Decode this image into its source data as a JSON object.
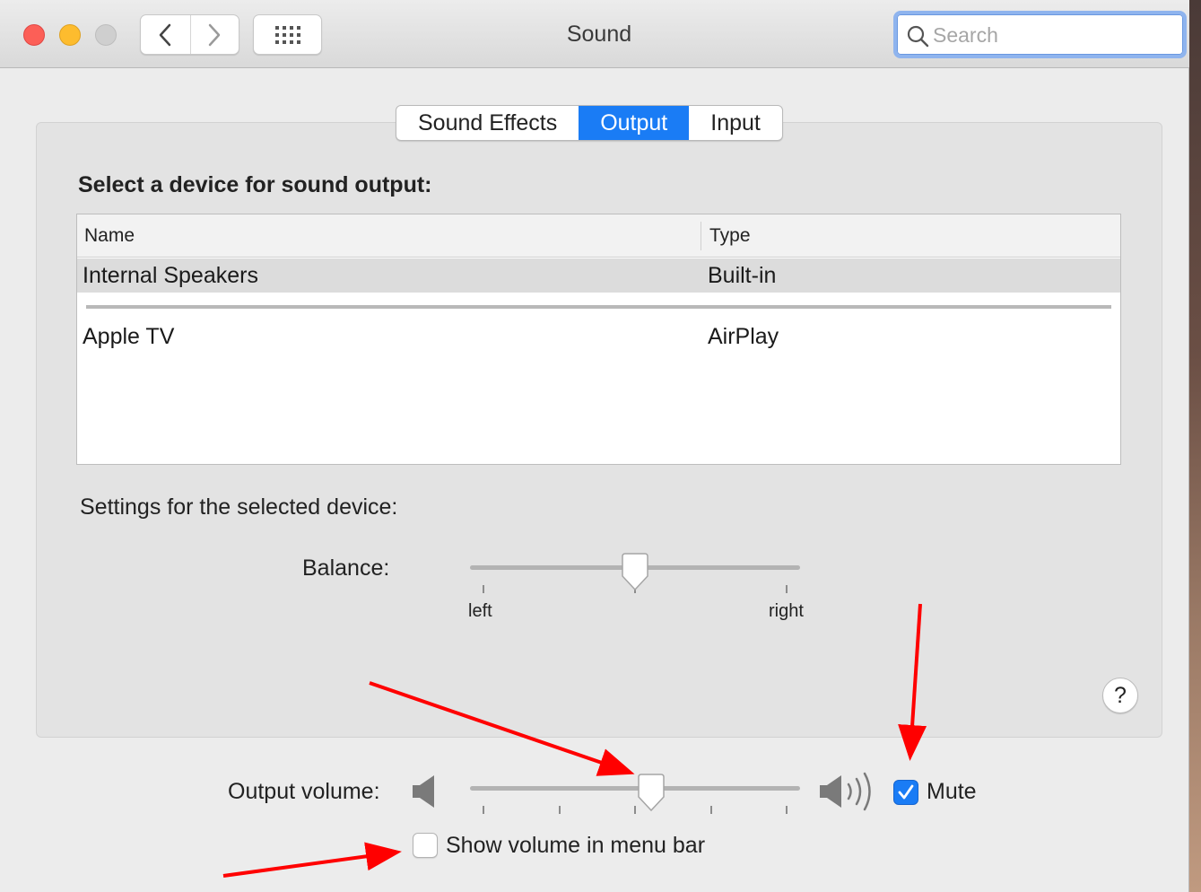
{
  "window": {
    "title": "Sound",
    "traffic_lights": [
      "close",
      "minimize",
      "zoom"
    ]
  },
  "toolbar": {
    "back_icon": "chevron-left-icon",
    "forward_icon": "chevron-right-icon",
    "show_all_icon": "grid-icon",
    "search_placeholder": "Search",
    "search_value": ""
  },
  "tabs": [
    {
      "label": "Sound Effects",
      "active": false
    },
    {
      "label": "Output",
      "active": true
    },
    {
      "label": "Input",
      "active": false
    }
  ],
  "output": {
    "section_title": "Select a device for sound output:",
    "columns": [
      "Name",
      "Type"
    ],
    "devices": [
      {
        "name": "Internal Speakers",
        "type": "Built-in",
        "selected": true
      },
      {
        "name": "Apple TV",
        "type": "AirPlay",
        "selected": false
      }
    ],
    "settings_label": "Settings for the selected device:",
    "balance": {
      "label": "Balance:",
      "left_label": "left",
      "right_label": "right",
      "value": 0.5
    },
    "help_label": "?"
  },
  "volume": {
    "label": "Output volume:",
    "value": 0.55,
    "low_icon": "speaker-low-icon",
    "high_icon": "speaker-high-icon",
    "mute_label": "Mute",
    "mute_checked": true,
    "menubar_label": "Show volume in menu bar",
    "menubar_checked": false
  },
  "colors": {
    "accent": "#1a7cf5",
    "annotation_arrow": "#ff0000"
  }
}
